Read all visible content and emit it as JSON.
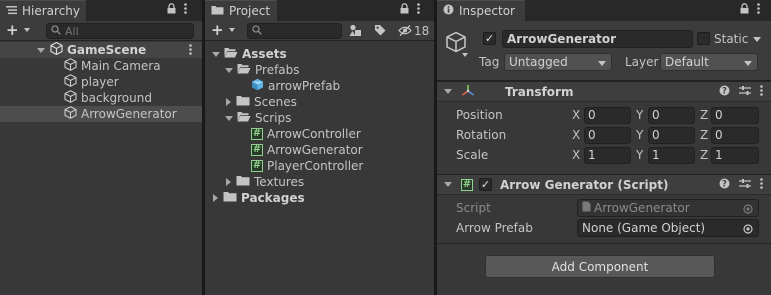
{
  "hierarchy": {
    "tab_label": "Hierarchy",
    "search_placeholder": "All",
    "scene_name": "GameScene",
    "items": [
      {
        "label": "Main Camera"
      },
      {
        "label": "player"
      },
      {
        "label": "background"
      },
      {
        "label": "ArrowGenerator"
      }
    ]
  },
  "project": {
    "tab_label": "Project",
    "hidden_count": "18",
    "tree": {
      "assets": "Assets",
      "prefabs": "Prefabs",
      "arrow_prefab": "arrowPrefab",
      "scenes": "Scenes",
      "scrips": "Scrips",
      "scripts": [
        "ArrowController",
        "ArrowGenerator",
        "PlayerController"
      ],
      "textures": "Textures",
      "packages": "Packages"
    }
  },
  "inspector": {
    "tab_label": "Inspector",
    "object_name": "ArrowGenerator",
    "static_label": "Static",
    "tag_label": "Tag",
    "tag_value": "Untagged",
    "layer_label": "Layer",
    "layer_value": "Default",
    "transform": {
      "title": "Transform",
      "rows": [
        {
          "label": "Position",
          "x": "0",
          "y": "0",
          "z": "0"
        },
        {
          "label": "Rotation",
          "x": "0",
          "y": "0",
          "z": "0"
        },
        {
          "label": "Scale",
          "x": "1",
          "y": "1",
          "z": "1"
        }
      ],
      "axis_x": "X",
      "axis_y": "Y",
      "axis_z": "Z"
    },
    "script_component": {
      "title": "Arrow Generator (Script)",
      "script_label": "Script",
      "script_value": "ArrowGenerator",
      "prefab_label": "Arrow Prefab",
      "prefab_value": "None (Game Object)"
    },
    "add_component_label": "Add Component"
  }
}
